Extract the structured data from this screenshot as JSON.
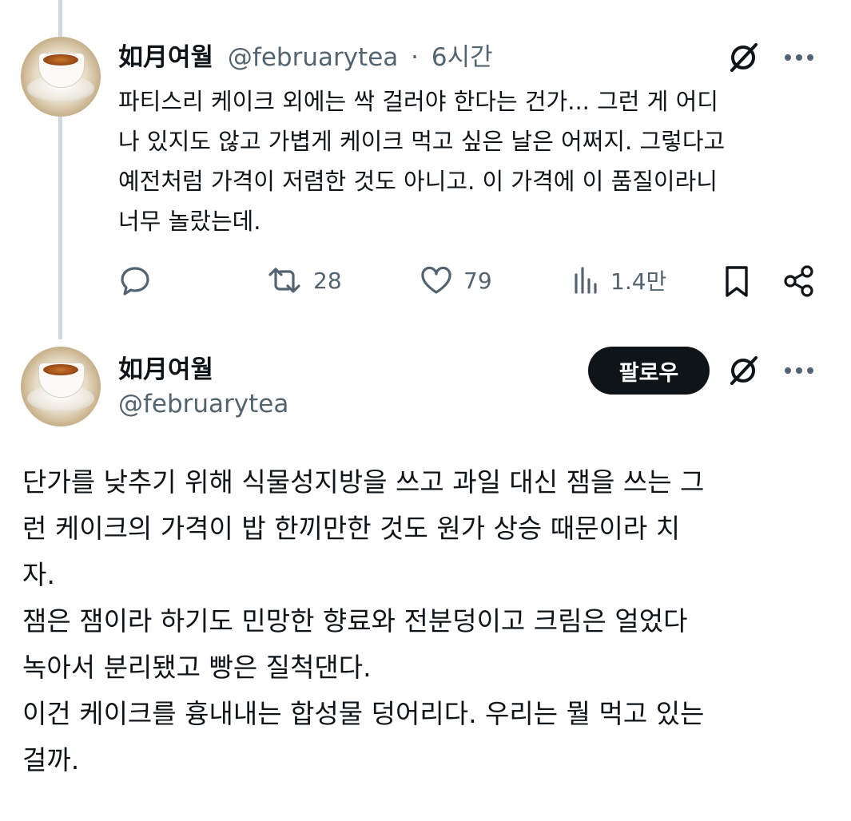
{
  "post1": {
    "name": "如月여월",
    "handle": "@februarytea",
    "separator": "·",
    "time": "6시간",
    "text": "파티스리 케이크 외에는 싹 걸러야 한다는 건가... 그런 게 어디\n나 있지도 않고 가볍게 케이크 먹고 싶은 날은 어쩌지. 그렇다고\n예전처럼 가격이 저렴한 것도 아니고. 이 가격에 이 품질이라니\n너무 놀랐는데.",
    "retweets": "28",
    "likes": "79",
    "views": "1.4만"
  },
  "post2": {
    "name": "如月여월",
    "handle": "@februarytea",
    "follow_label": "팔로우",
    "text": "단가를 낮추기 위해 식물성지방을 쓰고 과일 대신 잼을 쓰는 그\n런 케이크의 가격이 밥 한끼만한 것도 원가 상승 때문이라 치\n자.\n잼은 잼이라 하기도 민망한 향료와 전분덩이고 크림은 얼었다\n녹아서 분리됐고 빵은 질척댄다.\n이건 케이크를 흉내내는 합성물 덩어리다. 우리는 뭘 먹고 있는\n걸까."
  },
  "icons": {
    "grok": "grok-icon",
    "more": "more-icon",
    "reply": "reply-icon",
    "retweet": "retweet-icon",
    "like": "heart-icon",
    "views": "views-icon",
    "bookmark": "bookmark-icon",
    "share": "share-icon"
  },
  "colors": {
    "text": "#0f1419",
    "muted": "#536471",
    "thread_line": "#cfd9de",
    "follow_bg": "#0f1419"
  }
}
